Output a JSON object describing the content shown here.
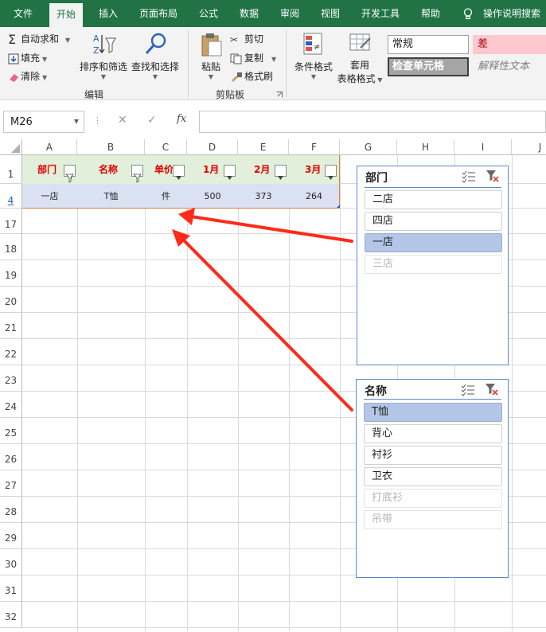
{
  "tabs": [
    "文件",
    "开始",
    "插入",
    "页面布局",
    "公式",
    "数据",
    "审阅",
    "视图",
    "开发工具",
    "帮助"
  ],
  "tell_me": "操作说明搜索",
  "editing": {
    "autosum": "自动求和",
    "fill": "填充",
    "clear": "清除",
    "sort_filter": "排序和筛选",
    "find_select": "查找和选择",
    "group": "编辑"
  },
  "clipboard": {
    "paste": "粘贴",
    "cut": "剪切",
    "copy": "复制",
    "format_painter": "格式刷",
    "group": "剪贴板"
  },
  "styles": {
    "cond_format": "条件格式",
    "table_line1": "套用",
    "table_line2": "表格格式",
    "normal": "常规",
    "bad": "差",
    "check_cell": "检查单元格",
    "explanatory": "解释性文本"
  },
  "formula_bar": {
    "name_box": "M26",
    "fx": "fx",
    "formula": ""
  },
  "columns": [
    "A",
    "B",
    "C",
    "D",
    "E",
    "F",
    "G",
    "H",
    "I",
    "J"
  ],
  "rows": [
    "1",
    "4",
    "17",
    "18",
    "19",
    "20",
    "21",
    "22",
    "23",
    "24",
    "25",
    "26",
    "27",
    "28",
    "29",
    "30",
    "31",
    "32"
  ],
  "headers": [
    "部门",
    "名称",
    "单价",
    "1月",
    "2月",
    "3月"
  ],
  "data_row": [
    "一店",
    "T恤",
    "件",
    "500",
    "373",
    "264"
  ],
  "slicer_dept": {
    "title": "部门",
    "items": [
      {
        "label": "二店",
        "state": "normal"
      },
      {
        "label": "四店",
        "state": "normal"
      },
      {
        "label": "一店",
        "state": "selected"
      },
      {
        "label": "三店",
        "state": "nodata"
      }
    ]
  },
  "slicer_name": {
    "title": "名称",
    "items": [
      {
        "label": "T恤",
        "state": "selected"
      },
      {
        "label": "背心",
        "state": "normal"
      },
      {
        "label": "衬衫",
        "state": "normal"
      },
      {
        "label": "卫衣",
        "state": "normal"
      },
      {
        "label": "打底衫",
        "state": "nodata"
      },
      {
        "label": "吊带",
        "state": "nodata"
      }
    ]
  },
  "colors": {
    "accent": "#217346",
    "header_fill": "#e2efda",
    "header_text": "#e00000",
    "row_fill": "#d9e1f2",
    "slicer_selected": "#b4c6e7",
    "arrow": "#ff2a1a"
  }
}
